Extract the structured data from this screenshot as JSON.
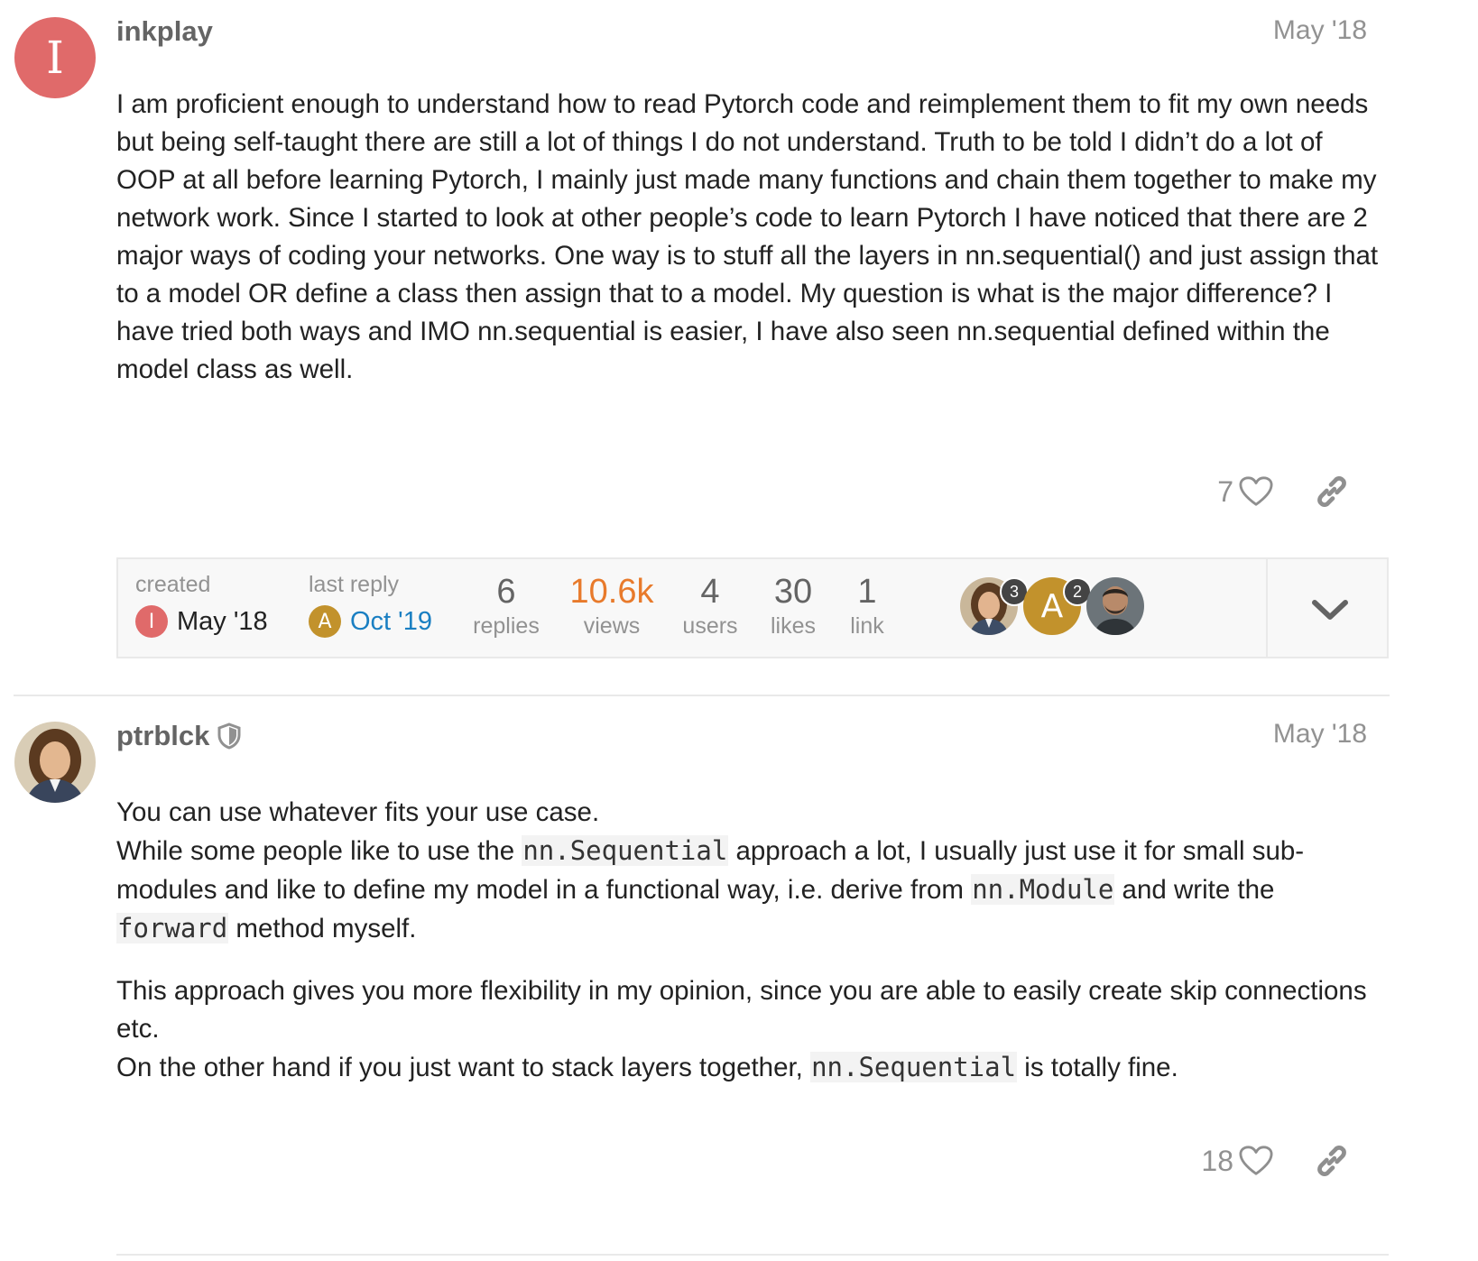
{
  "posts": [
    {
      "username": "inkplay",
      "avatar_letter": "I",
      "date": "May '18",
      "body": "I am proficient enough to understand how to read Pytorch code and reimplement them to fit my own needs but being self-taught there are still a lot of things I do not understand. Truth to be told I didn’t do a lot of OOP at all before learning Pytorch, I mainly just made many functions and chain them together to make my network work. Since I started to look at other people’s code to learn Pytorch I have noticed that there are 2 major ways of coding your networks. One way is to stuff all the layers in nn.sequential() and just assign that to a model OR define a class then assign that to a model. My question is what is the major difference? I have tried both ways and IMO nn.sequential is easier, I have also seen nn.sequential defined within the model class as well.",
      "likes": "7"
    },
    {
      "username": "ptrblck",
      "date": "May '18",
      "p1_line1": "You can use whatever fits your use case.",
      "p1_a": "While some people like to use the ",
      "p1_code1": "nn.Sequential",
      "p1_b": " approach a lot, I usually just use it for small sub-modules and like to define my model in a functional way, i.e. derive from ",
      "p1_code2": "nn.Module",
      "p1_c": " and write the ",
      "p1_code3": "forward",
      "p1_d": " method myself.",
      "p2_a": "This approach gives you more flexibility in my opinion, since you are able to easily create skip connections etc.",
      "p2_b": "On the other hand if you just want to stack layers together, ",
      "p2_code": "nn.Sequential",
      "p2_c": " is totally fine.",
      "likes": "18"
    }
  ],
  "topic_map": {
    "created_label": "created",
    "created_avatar_letter": "I",
    "created_value": "May '18",
    "last_reply_label": "last reply",
    "last_reply_avatar_letter": "A",
    "last_reply_value": "Oct '19",
    "stats": [
      {
        "num": "6",
        "label": "replies"
      },
      {
        "num": "10.6k",
        "label": "views"
      },
      {
        "num": "4",
        "label": "users"
      },
      {
        "num": "30",
        "label": "likes"
      },
      {
        "num": "1",
        "label": "link"
      }
    ],
    "participants": [
      {
        "badge": "3"
      },
      {
        "letter": "A",
        "badge": "2"
      },
      {}
    ]
  },
  "colors": {
    "avatar_i": "#e06a6a",
    "avatar_a": "#c2922c",
    "views_hot": "#e87a2b",
    "link_blue": "#1a7fc2"
  }
}
